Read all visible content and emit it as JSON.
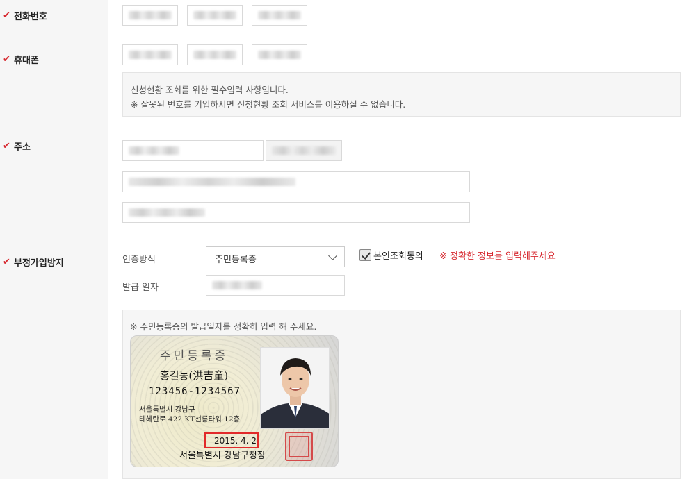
{
  "rows": {
    "phone": {
      "label": "전화번호",
      "required_mark": "✔"
    },
    "mobile": {
      "label": "휴대폰",
      "required_mark": "✔",
      "notice_line1": "신청현황 조회를 위한 필수입력 사항입니다.",
      "notice_line2": "※ 잘못된 번호를 기입하시면 신청현황 조회 서비스를 이용하실 수 없습니다."
    },
    "address": {
      "label": "주소",
      "required_mark": "✔"
    },
    "fraud_prevention": {
      "label": "부정가입방지",
      "required_mark": "✔",
      "auth_method_label": "인증방식",
      "auth_method_selected": "주민등록증",
      "identity_agree_label": "본인조회동의",
      "identity_agree_checked": true,
      "warning": "※ 정확한 정보를 입력해주세요",
      "issue_date_label": "발급 일자",
      "guide_text": "※ 주민등록증의 발급일자를 정확히 입력 해 주세요."
    }
  },
  "id_card": {
    "title": "주민등록증",
    "name": "홍길동(洪吉童)",
    "id_number": "123456-1234567",
    "address_line1": "서울특별시 강남구",
    "address_line2": "테헤란로 422 KT선릉타워 12층",
    "issue_date": "2015. 4. 2",
    "issuer": "서울특별시 강남구청장"
  },
  "colors": {
    "accent_red": "#d7282f",
    "label_bg": "#f6f6f6",
    "border": "#e2e2e2"
  }
}
